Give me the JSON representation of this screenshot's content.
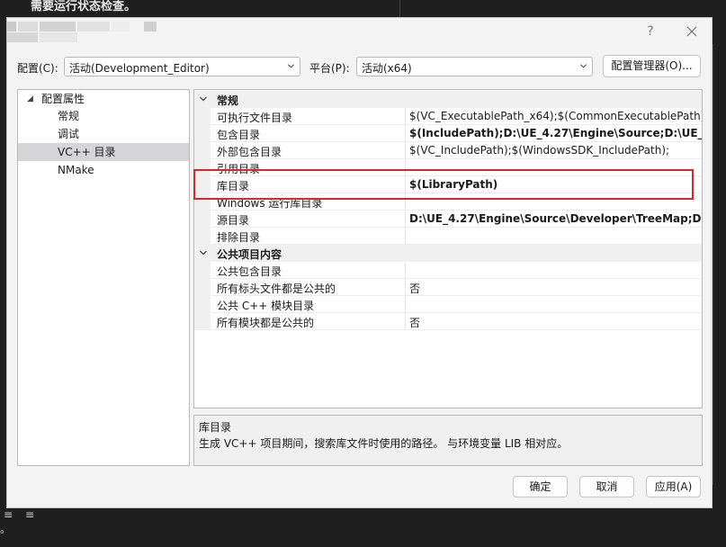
{
  "background": {
    "top_text": "需要运行状态检查。",
    "bottom_glyph_1": "≡",
    "bottom_glyph_2": "≡",
    "bottom_glyph_3": "。"
  },
  "titlebar": {
    "help_label": "?",
    "close_icon": "close-icon"
  },
  "toolbar": {
    "config_label": "配置(C):",
    "config_value": "活动(Development_Editor)",
    "platform_label": "平台(P):",
    "platform_value": "活动(x64)",
    "config_manager_label": "配置管理器(O)..."
  },
  "tree": {
    "root": "配置属性",
    "items": [
      {
        "label": "常规"
      },
      {
        "label": "调试"
      },
      {
        "label": "VC++ 目录"
      },
      {
        "label": "NMake"
      }
    ]
  },
  "grid": {
    "categories": [
      {
        "name": "常规",
        "rows": [
          {
            "name": "可执行文件目录",
            "value": "$(VC_ExecutablePath_x64);$(CommonExecutablePath)"
          },
          {
            "name": "包含目录",
            "value": "$(IncludePath);D:\\UE_4.27\\Engine\\Source;D:\\UE_4.27\\"
          },
          {
            "name": "外部包含目录",
            "value": "$(VC_IncludePath);$(WindowsSDK_IncludePath);"
          },
          {
            "name": "引用目录",
            "value": ""
          },
          {
            "name": "库目录",
            "value": "$(LibraryPath)"
          },
          {
            "name": "Windows 运行库目录",
            "value": ""
          },
          {
            "name": "源目录",
            "value": "D:\\UE_4.27\\Engine\\Source\\Developer\\TreeMap;D:\\UE"
          },
          {
            "name": "排除目录",
            "value": ""
          }
        ]
      },
      {
        "name": "公共项目内容",
        "rows": [
          {
            "name": "公共包含目录",
            "value": ""
          },
          {
            "name": "所有标头文件都是公共的",
            "value": "否"
          },
          {
            "name": "公共 C++ 模块目录",
            "value": ""
          },
          {
            "name": "所有模块都是公共的",
            "value": "否"
          }
        ]
      }
    ]
  },
  "description": {
    "title": "库目录",
    "text": "生成 VC++ 项目期间，搜索库文件时使用的路径。 与环境变量 LIB 相对应。"
  },
  "buttons": {
    "ok": "确定",
    "cancel": "取消",
    "apply": "应用(A)"
  },
  "colors": {
    "highlight_border": "#d62a2a",
    "selected_tree_item": "#d4d4d9"
  }
}
